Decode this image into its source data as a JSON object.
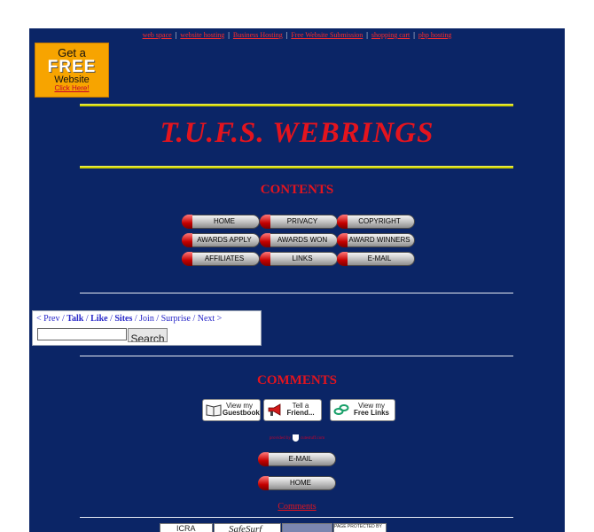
{
  "top_links": [
    "web space",
    "website hosting",
    "Business Hosting",
    "Free Website Submission",
    "shopping cart",
    "php hosting"
  ],
  "top_links_separator": "|",
  "ad": {
    "line1": "Get a",
    "line2": "FREE",
    "line3": "Website",
    "cta": "Click Here!"
  },
  "title": "T.U.F.S. WEBRINGS",
  "contents_heading": "CONTENTS",
  "nav_buttons": [
    "HOME",
    "PRIVACY",
    "COPYRIGHT",
    "AWARDS APPLY",
    "AWARDS WON",
    "AWARD WINNERS",
    "AFFILIATES",
    "LINKS",
    "E-MAIL"
  ],
  "webring": {
    "prev": "< Prev",
    "sep": " / ",
    "talk": "Talk",
    "like": "Like",
    "sites": "Sites",
    "join": "Join",
    "surprise": "Surprise",
    "next": "Next >",
    "search_value": "",
    "search_label": "Search"
  },
  "comments_heading": "COMMENTS",
  "guest_buttons": [
    {
      "line1": "View my",
      "line2": "Guestbook"
    },
    {
      "line1": "Tell a",
      "line2": "Friend..."
    },
    {
      "line1": "View my",
      "line2": "Free Links"
    }
  ],
  "small_note": {
    "left": "provided by",
    "right": "cutestuff.com"
  },
  "bottom_buttons": [
    "E-MAIL",
    "HOME"
  ],
  "comments_link": "Comments",
  "badges": [
    "ICRA",
    "SafeSurf",
    "",
    "PAGE PROTECTED BY"
  ],
  "colors": {
    "background": "#0b2566",
    "heading_red": "#e3141e",
    "rule_yellow": "#cfd400",
    "ad_orange": "#f7a400"
  }
}
